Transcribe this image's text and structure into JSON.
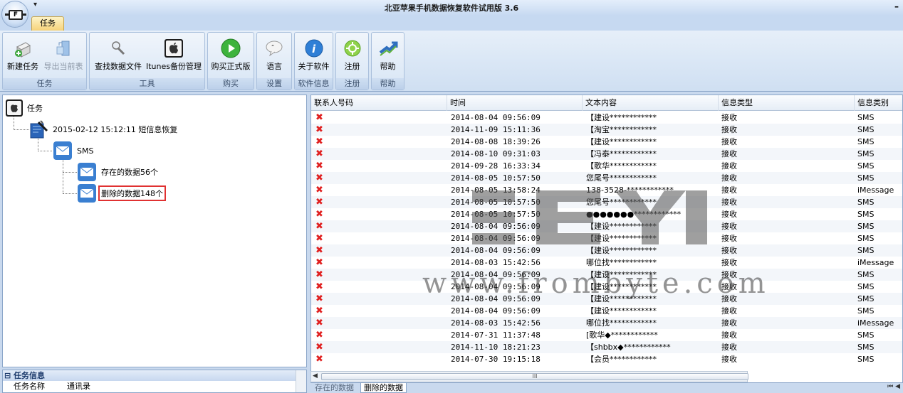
{
  "window": {
    "title": "北亚苹果手机数据恢复软件试用版 3.6",
    "qat_symbol": "▾",
    "minimize_symbol": "–",
    "app_button_letter": "F"
  },
  "tabs": [
    {
      "label": "任务"
    }
  ],
  "ribbon": {
    "groups": [
      {
        "label": "任务",
        "buttons": [
          {
            "label": "新建任务",
            "icon": "new-task-icon"
          },
          {
            "label": "导出当前表",
            "icon": "export-icon",
            "disabled": true
          }
        ]
      },
      {
        "label": "工具",
        "buttons": [
          {
            "label": "查找数据文件",
            "icon": "search-icon"
          },
          {
            "label": "Itunes备份管理",
            "icon": "apple-icon"
          }
        ]
      },
      {
        "label": "购买",
        "buttons": [
          {
            "label": "购买正式版",
            "icon": "play-icon"
          }
        ]
      },
      {
        "label": "设置",
        "buttons": [
          {
            "label": "语言",
            "icon": "speech-bubble-icon"
          }
        ]
      },
      {
        "label": "软件信息",
        "buttons": [
          {
            "label": "关于软件",
            "icon": "info-icon"
          }
        ]
      },
      {
        "label": "注册",
        "buttons": [
          {
            "label": "注册",
            "icon": "gear-icon"
          }
        ]
      },
      {
        "label": "帮助",
        "buttons": [
          {
            "label": "帮助",
            "icon": "help-arrow-icon"
          }
        ]
      }
    ]
  },
  "tree": {
    "root": "任务",
    "task": "2015-02-12 15:12:11 短信息恢复",
    "category": "SMS",
    "existing": "存在的数据56个",
    "deleted": "删除的数据148个"
  },
  "info_panel": {
    "title": "任务信息",
    "rows": [
      {
        "key": "任务名称",
        "value": "通讯录"
      }
    ]
  },
  "grid": {
    "columns": [
      "联系人号码",
      "时间",
      "文本内容",
      "信息类型",
      "信息类别"
    ],
    "rows": [
      [
        "",
        "2014-08-04  09:56:09",
        "【建设************",
        "接收",
        "SMS"
      ],
      [
        "",
        "2014-11-09  15:11:36",
        "【淘宝************",
        "接收",
        "SMS"
      ],
      [
        "",
        "2014-08-08  18:39:26",
        "【建设************",
        "接收",
        "SMS"
      ],
      [
        "",
        "2014-08-10  09:31:03",
        "【冯泰************",
        "接收",
        "SMS"
      ],
      [
        "",
        "2014-09-28  16:33:34",
        "【歌华************",
        "接收",
        "SMS"
      ],
      [
        "",
        "2014-08-05  10:57:50",
        "您尾号************",
        "接收",
        "SMS"
      ],
      [
        "",
        "2014-08-05  13:58:24",
        "138-3528-************",
        "接收",
        "iMessage"
      ],
      [
        "",
        "2014-08-05  10:57:50",
        "您尾号************",
        "接收",
        "SMS"
      ],
      [
        "",
        "2014-08-05  10:57:50",
        "●●●●●●●************",
        "接收",
        "SMS"
      ],
      [
        "",
        "2014-08-04  09:56:09",
        "【建设************",
        "接收",
        "SMS"
      ],
      [
        "",
        "2014-08-04  09:56:09",
        "【建设************",
        "接收",
        "SMS"
      ],
      [
        "",
        "2014-08-04  09:56:09",
        "【建设************",
        "接收",
        "SMS"
      ],
      [
        "",
        "2014-08-03  15:42:56",
        "哪位找************",
        "接收",
        "iMessage"
      ],
      [
        "",
        "2014-08-04  09:56:09",
        "【建设************",
        "接收",
        "SMS"
      ],
      [
        "",
        "2014-08-04  09:56:09",
        "【建设************",
        "接收",
        "SMS"
      ],
      [
        "",
        "2014-08-04  09:56:09",
        "【建设************",
        "接收",
        "SMS"
      ],
      [
        "",
        "2014-08-04  09:56:09",
        "【建设************",
        "接收",
        "SMS"
      ],
      [
        "",
        "2014-08-03  15:42:56",
        "哪位找************",
        "接收",
        "iMessage"
      ],
      [
        "",
        "2014-07-31  11:37:48",
        "[歌华◆************",
        "接收",
        "SMS"
      ],
      [
        "",
        "2014-11-10  18:21:23",
        "【shbbx◆************",
        "接收",
        "SMS"
      ],
      [
        "",
        "2014-07-30  19:15:18",
        "【会员************",
        "接收",
        "SMS"
      ]
    ],
    "row_icon": "✖"
  },
  "scrollbar": {
    "thumb_label": "III"
  },
  "bottom_tabs": [
    {
      "label": "存在的数据"
    },
    {
      "label": "删除的数据",
      "active": true
    }
  ],
  "watermark": "www.frombyte.com",
  "colors": {
    "delete_red": "#e02020",
    "highlight_red": "#e03131"
  }
}
